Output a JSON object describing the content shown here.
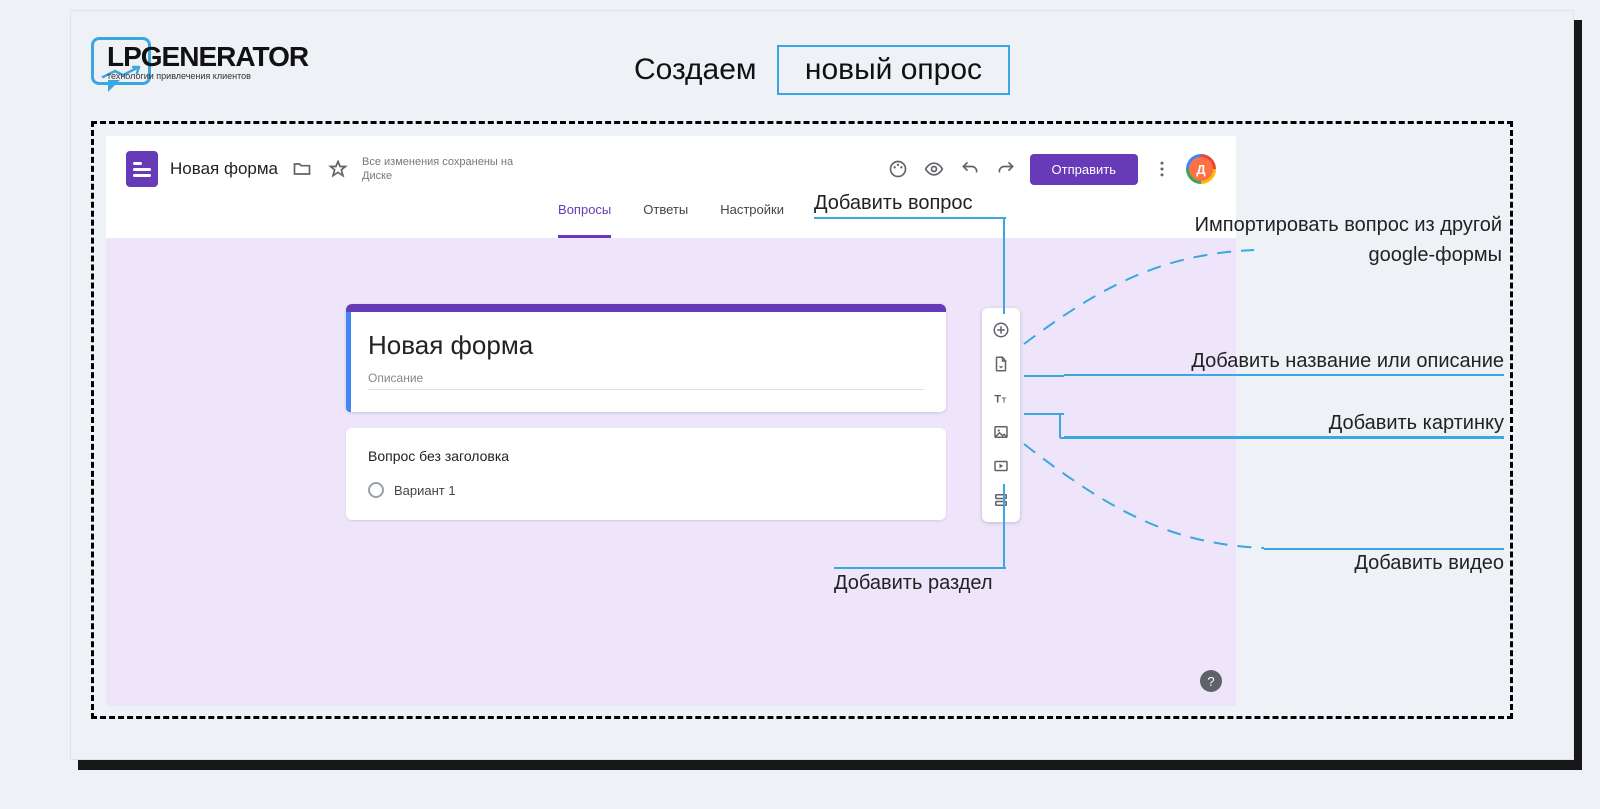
{
  "branding": {
    "logo_text": "LPGENERATOR",
    "logo_sub": "технологии привлечения клиентов"
  },
  "slide": {
    "title_plain": "Создаем",
    "title_boxed": "новый опрос"
  },
  "gform": {
    "doc_title": "Новая форма",
    "save_note": "Все изменения сохранены на Диске",
    "send_button": "Отправить",
    "avatar_letter": "Д",
    "tabs": {
      "questions": "Вопросы",
      "answers": "Ответы",
      "settings": "Настройки"
    },
    "form": {
      "title": "Новая форма",
      "description_placeholder": "Описание",
      "question_placeholder": "Вопрос без заголовка",
      "option1": "Вариант 1"
    }
  },
  "annotations": {
    "add_question": "Добавить вопрос",
    "import_question": "Импортировать вопрос из другой google-формы",
    "import_question_line1": "Импортировать вопрос из другой",
    "import_question_line2": "google-формы",
    "add_title": "Добавить название или описание",
    "add_image": "Добавить картинку",
    "add_video": "Добавить видео",
    "add_section": "Добавить раздел"
  }
}
